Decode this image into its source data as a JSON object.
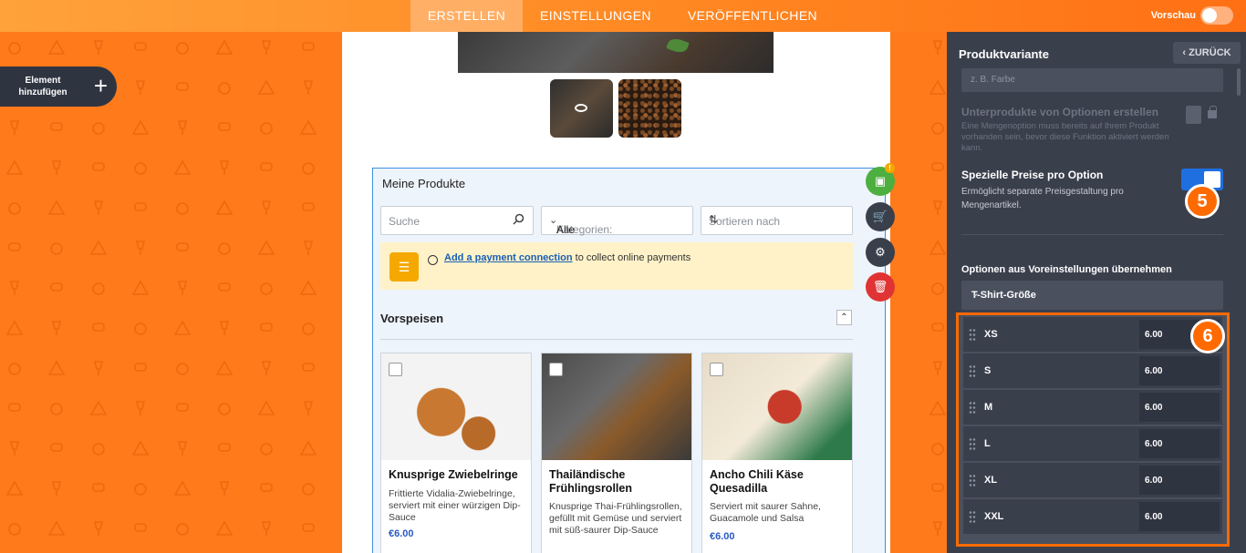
{
  "topbar": {
    "tabs": [
      {
        "label": "ERSTELLEN",
        "active": true
      },
      {
        "label": "EINSTELLUNGEN",
        "active": false
      },
      {
        "label": "VERÖFFENTLICHEN",
        "active": false
      }
    ],
    "preview_label": "Vorschau",
    "preview_on": false
  },
  "left": {
    "add_element_line1": "Element",
    "add_element_line2": "hinzufügen",
    "add_icon": "plus-icon"
  },
  "widget": {
    "title": "Meine Produkte",
    "search_placeholder": "Suche",
    "category_prefix": "Kategorien:",
    "category_value": "Alle",
    "sort_placeholder": "Sortieren nach",
    "banner_link": "Add a payment connection",
    "banner_text": " to collect online payments",
    "category_title": "Vorspeisen",
    "cards": [
      {
        "name": "Knusprige Zwiebelringe",
        "desc": "Frittierte Vidalia-Zwiebelringe, serviert mit einer würzigen Dip-Sauce",
        "price": "€6.00"
      },
      {
        "name": "Thailändische Frühlingsrollen",
        "desc": "Knusprige Thai-Frühlingsrollen, gefüllt mit Gemüse und serviert mit süß-saurer Dip-Sauce",
        "price": ""
      },
      {
        "name": "Ancho Chili Käse Quesadilla",
        "desc": "Serviert mit saurer Sahne, Guacamole und Salsa",
        "price": "€6.00"
      }
    ]
  },
  "side_buttons": [
    {
      "icon": "payment-card-icon",
      "color": "#4caf3f"
    },
    {
      "icon": "cart-icon",
      "color": "#3a3f4c"
    },
    {
      "icon": "gear-icon",
      "color": "#3a3f4c"
    },
    {
      "icon": "trash-icon",
      "color": "#e03434"
    }
  ],
  "panel": {
    "title": "Produktvariante",
    "back_label": "ZURÜCK",
    "input_placeholder": "z. B. Farbe",
    "subproducts_title": "Unterprodukte von Optionen erstellen",
    "subproducts_desc": "Eine Mengenoption muss bereits auf Ihrem Produkt vorhanden sein, bevor diese Funktion aktiviert werden kann.",
    "special_title": "Spezielle Preise pro Option",
    "special_desc": "Ermöglicht separate Preisgestaltung pro Mengenartikel.",
    "special_on": true,
    "step5": "5",
    "step6": "6",
    "presets_label": "Optionen aus Voreinstellungen übernehmen",
    "presets_value": "T-Shirt-Größe",
    "options": [
      {
        "size": "XS",
        "price": "6.00"
      },
      {
        "size": "S",
        "price": "6.00"
      },
      {
        "size": "M",
        "price": "6.00"
      },
      {
        "size": "L",
        "price": "6.00"
      },
      {
        "size": "XL",
        "price": "6.00"
      },
      {
        "size": "XXL",
        "price": "6.00"
      }
    ]
  },
  "colors": {
    "accent_orange": "#ff7a1a",
    "panel_dark": "#3a3f4c",
    "link_blue": "#1a5fb4",
    "toggle_blue": "#1f6fe0"
  }
}
